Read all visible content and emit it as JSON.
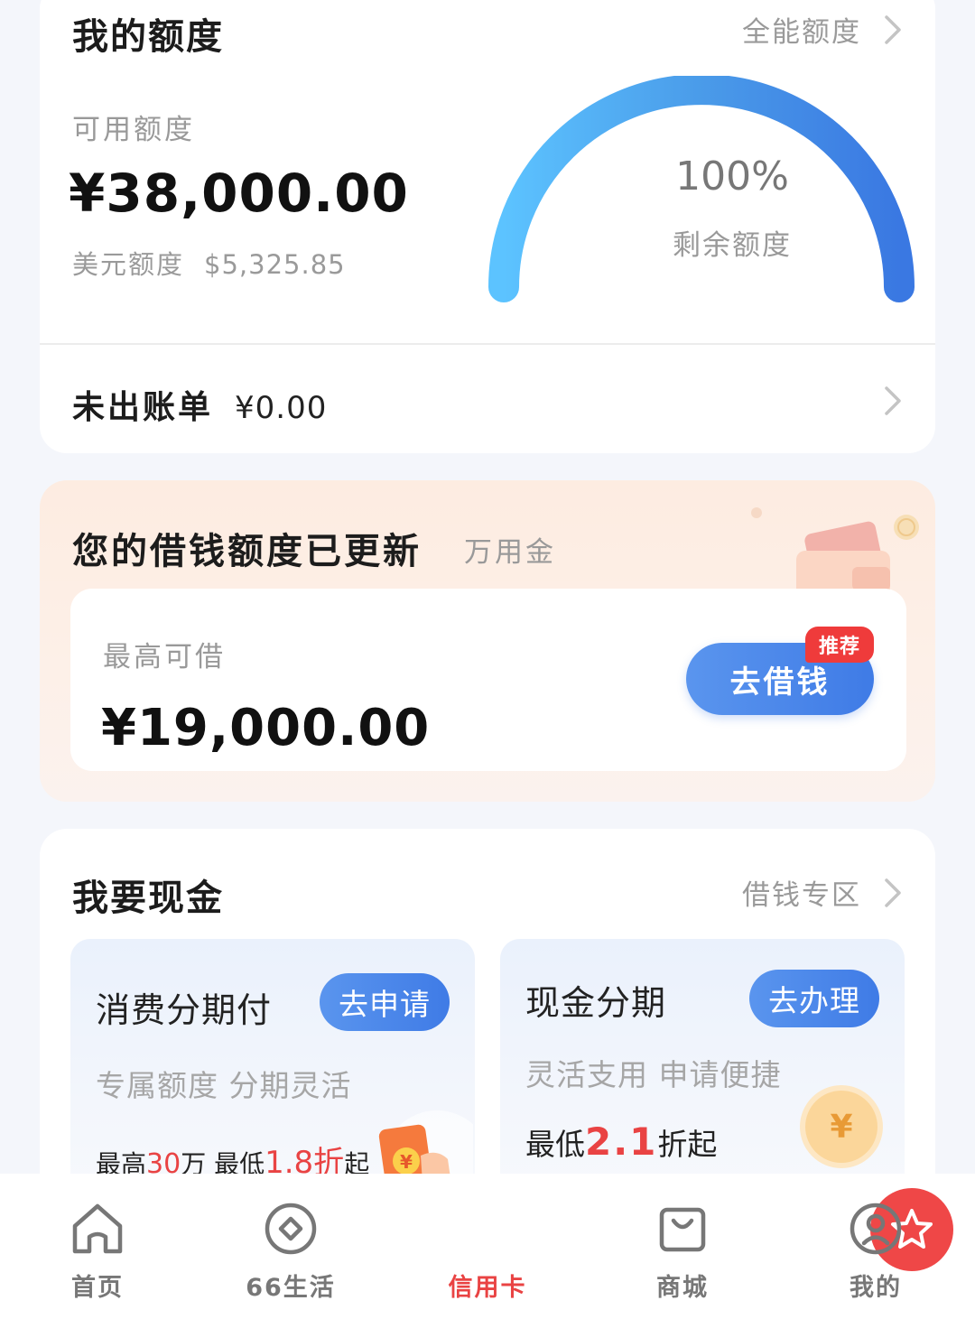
{
  "limit": {
    "title": "我的额度",
    "link": "全能额度",
    "available_label": "可用额度",
    "available_amount": "¥38,000.00",
    "usd_label": "美元额度",
    "usd_amount": "$5,325.85",
    "gauge_percent_text": "100%",
    "gauge_percent_value": 1.0,
    "gauge_label": "剩余额度",
    "bill_label": "未出账单",
    "bill_amount": "¥0.00"
  },
  "loan": {
    "title": "您的借钱额度已更新",
    "subtitle": "万用金",
    "max_label": "最高可借",
    "max_amount": "¥19,000.00",
    "button": "去借钱",
    "badge": "推荐"
  },
  "cash": {
    "title": "我要现金",
    "link": "借钱专区",
    "tiles": [
      {
        "title": "消费分期付",
        "button": "去申请",
        "desc": "专属额度 分期灵活",
        "rate_prefix": "最高",
        "rate_highlight1": "30",
        "rate_mid": "万 最低",
        "rate_highlight2": "1.8折",
        "rate_suffix": "起"
      },
      {
        "title": "现金分期",
        "button": "去办理",
        "desc": "灵活支用 申请便捷",
        "rate_prefix": "最低",
        "rate_highlight": "2.1",
        "rate_suffix": "折起",
        "coin_symbol": "¥"
      }
    ]
  },
  "tabbar": {
    "items": [
      {
        "label": "首页",
        "icon": "home-icon"
      },
      {
        "label": "66生活",
        "icon": "diamond-circle-icon"
      },
      {
        "label": "信用卡",
        "icon": "star-icon",
        "active": true
      },
      {
        "label": "商城",
        "icon": "shopping-bag-icon"
      },
      {
        "label": "我的",
        "icon": "profile-icon"
      }
    ]
  },
  "colors": {
    "accent_blue": "#3f7be6",
    "accent_red": "#e94343"
  }
}
